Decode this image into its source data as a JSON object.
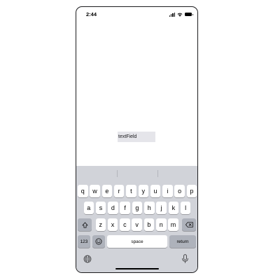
{
  "status_bar": {
    "time": "2:44",
    "icons": [
      "cellular-signal-icon",
      "wifi-icon",
      "battery-icon"
    ]
  },
  "text_field": {
    "value": "textField"
  },
  "keyboard": {
    "row1": [
      "q",
      "w",
      "e",
      "r",
      "t",
      "y",
      "u",
      "i",
      "o",
      "p"
    ],
    "row2": [
      "a",
      "s",
      "d",
      "f",
      "g",
      "h",
      "j",
      "k",
      "l"
    ],
    "row3": [
      "z",
      "x",
      "c",
      "v",
      "b",
      "n",
      "m"
    ],
    "numbers_label": "123",
    "space_label": "space",
    "return_label": "return",
    "icons": [
      "shift-icon",
      "backspace-icon",
      "emoji-icon",
      "globe-icon",
      "microphone-icon"
    ]
  },
  "colors": {
    "keyboard_background": "#d1d3d9",
    "key_light": "#ffffff",
    "key_dark": "#aeb2bb",
    "text_field_background": "#e5e5ea"
  }
}
